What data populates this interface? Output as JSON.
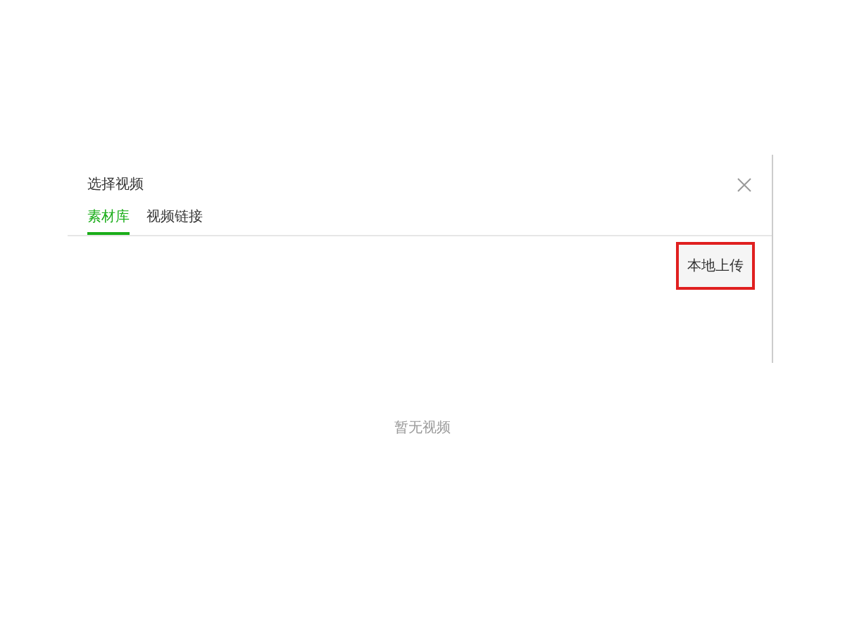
{
  "dialog": {
    "title": "选择视频",
    "tabs": [
      {
        "label": "素材库",
        "selected": true
      },
      {
        "label": "视频链接",
        "selected": false
      }
    ],
    "upload_button": {
      "label": "本地上传",
      "highlighted": true
    }
  },
  "empty_message": "暂无视频"
}
